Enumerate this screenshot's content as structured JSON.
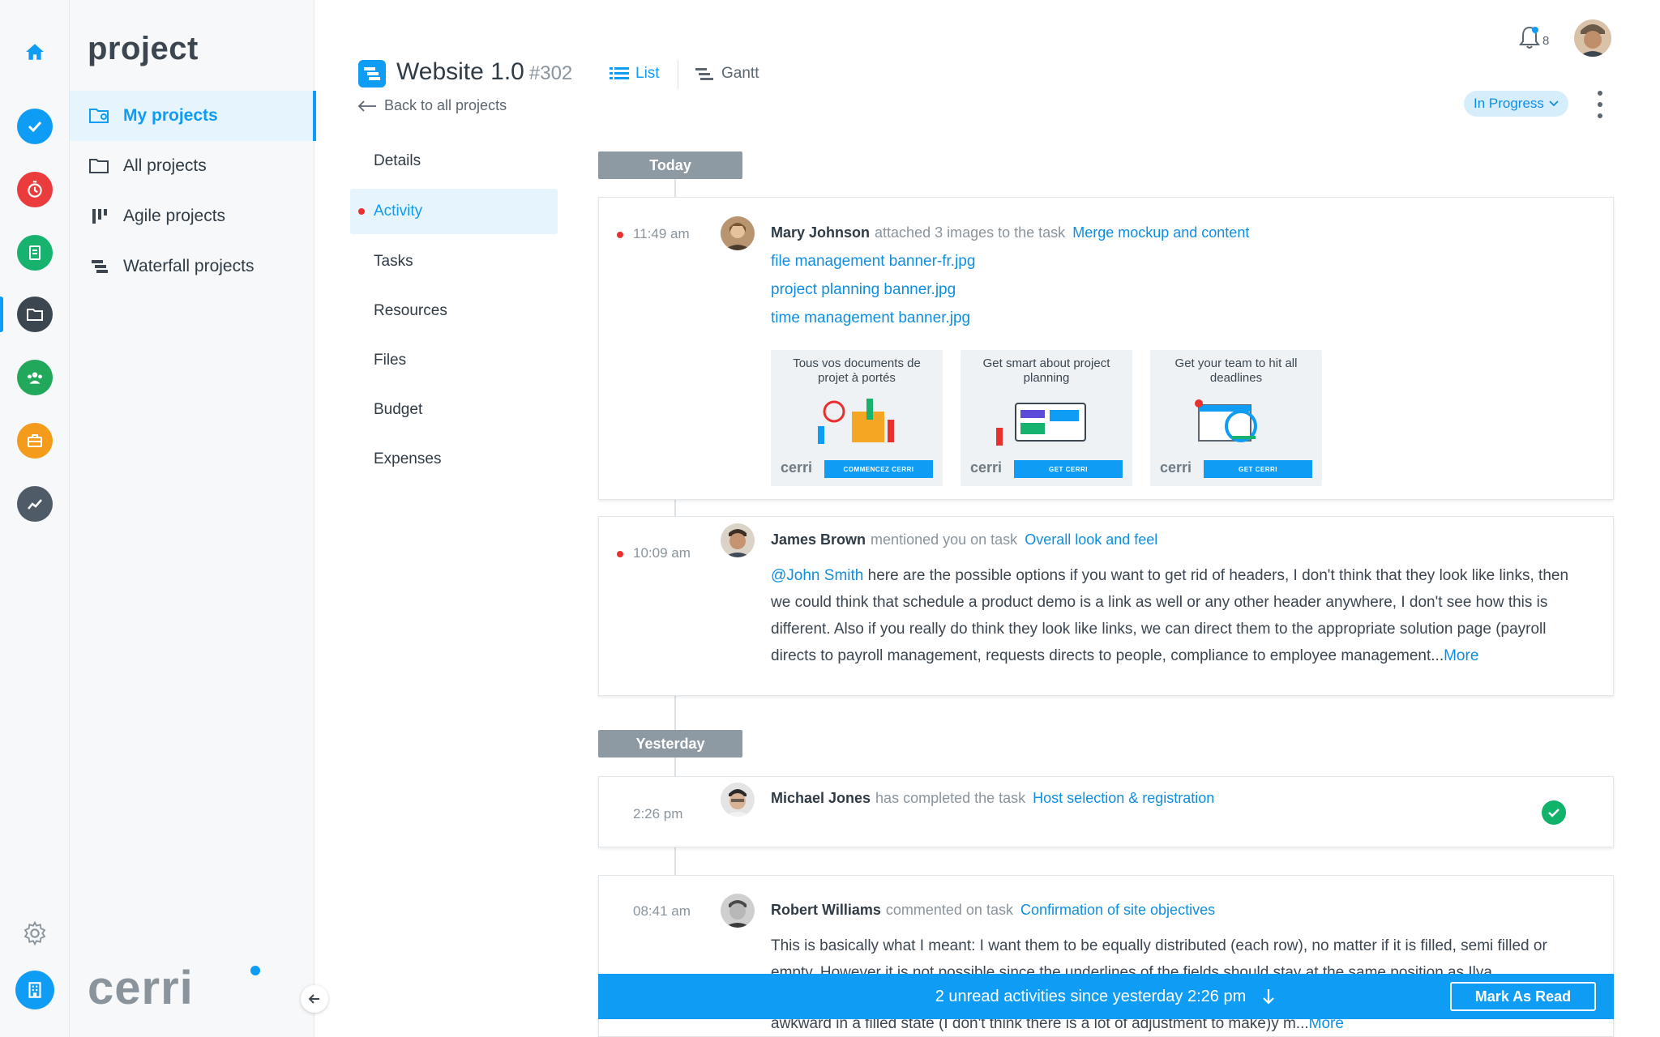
{
  "app": {
    "section_title": "project",
    "logo_text": "cerri"
  },
  "rail": {
    "icons": [
      "home-icon",
      "tasks-check-icon",
      "timer-icon",
      "document-icon",
      "folder-icon",
      "team-icon",
      "briefcase-icon",
      "analytics-icon",
      "settings-icon",
      "building-icon"
    ]
  },
  "project_nav": {
    "items": [
      {
        "label": "My projects",
        "icon": "user-folder-icon"
      },
      {
        "label": "All projects",
        "icon": "folder-icon"
      },
      {
        "label": "Agile projects",
        "icon": "agile-icon"
      },
      {
        "label": "Waterfall projects",
        "icon": "waterfall-icon"
      }
    ]
  },
  "header": {
    "title": "Website 1.0",
    "number": "#302",
    "back_label": "Back to all projects",
    "tabs": [
      {
        "label": "List",
        "icon": "list-icon"
      },
      {
        "label": "Gantt",
        "icon": "gantt-icon"
      }
    ],
    "notification_count": "8",
    "status": "In Progress"
  },
  "sub_nav": {
    "items": [
      "Details",
      "Activity",
      "Tasks",
      "Resources",
      "Files",
      "Budget",
      "Expenses"
    ]
  },
  "timeline": {
    "today_label": "Today",
    "yesterday_label": "Yesterday",
    "activities": [
      {
        "time": "11:49 am",
        "user": "Mary Johnson",
        "action": "attached 3 images to the task",
        "task": "Merge mockup and content",
        "files": [
          "file management banner-fr.jpg",
          "project planning banner.jpg",
          "time management banner.jpg"
        ],
        "thumbs": [
          {
            "caption": "Tous vos documents de projet à portés",
            "logo": "cerri",
            "button": "COMMENCEZ CERRI"
          },
          {
            "caption": "Get smart about project planning",
            "logo": "cerri",
            "button": "GET CERRI"
          },
          {
            "caption": "Get your team to hit all deadlines",
            "logo": "cerri",
            "button": "GET CERRI"
          }
        ]
      },
      {
        "time": "10:09 am",
        "user": "James Brown",
        "action": "mentioned you on task",
        "task": "Overall look and feel",
        "mention": "@John Smith",
        "text": " here are the possible options if you want to get rid of headers, I don't think that they look like links, then we could think that schedule a product demo is a link as well or any other header anywhere, I don't see how this is different. Also if you really do think they look like links, we can direct them to the appropriate solution page (payroll directs to payroll management, requests directs to people, compliance to employee management...",
        "more": "More"
      },
      {
        "time": "2:26 pm",
        "user": "Michael Jones",
        "action": "has completed the task",
        "task": "Host selection & registration"
      },
      {
        "time": "08:41 am",
        "user": "Robert Williams",
        "action": "commented on task",
        "task": "Confirmation of site objectives",
        "text_line1": "This is basically what I meant: I want them to be equally distributed (each row), no matter if it is filled, semi filled or",
        "text_line2": "empty. However it is not possible since the underlines of the fields should stay at the same position as Ilya",
        "text_line3": "awkward in a filled state (I don't think there is a lot of adjustment to make)y m...",
        "more": "More"
      }
    ]
  },
  "banner": {
    "text": "2 unread activities since yesterday 2:26 pm",
    "button": "Mark As Read"
  },
  "colors": {
    "accent": "#0f9cf5",
    "unread": "#e8302f",
    "success": "#11b36b"
  }
}
